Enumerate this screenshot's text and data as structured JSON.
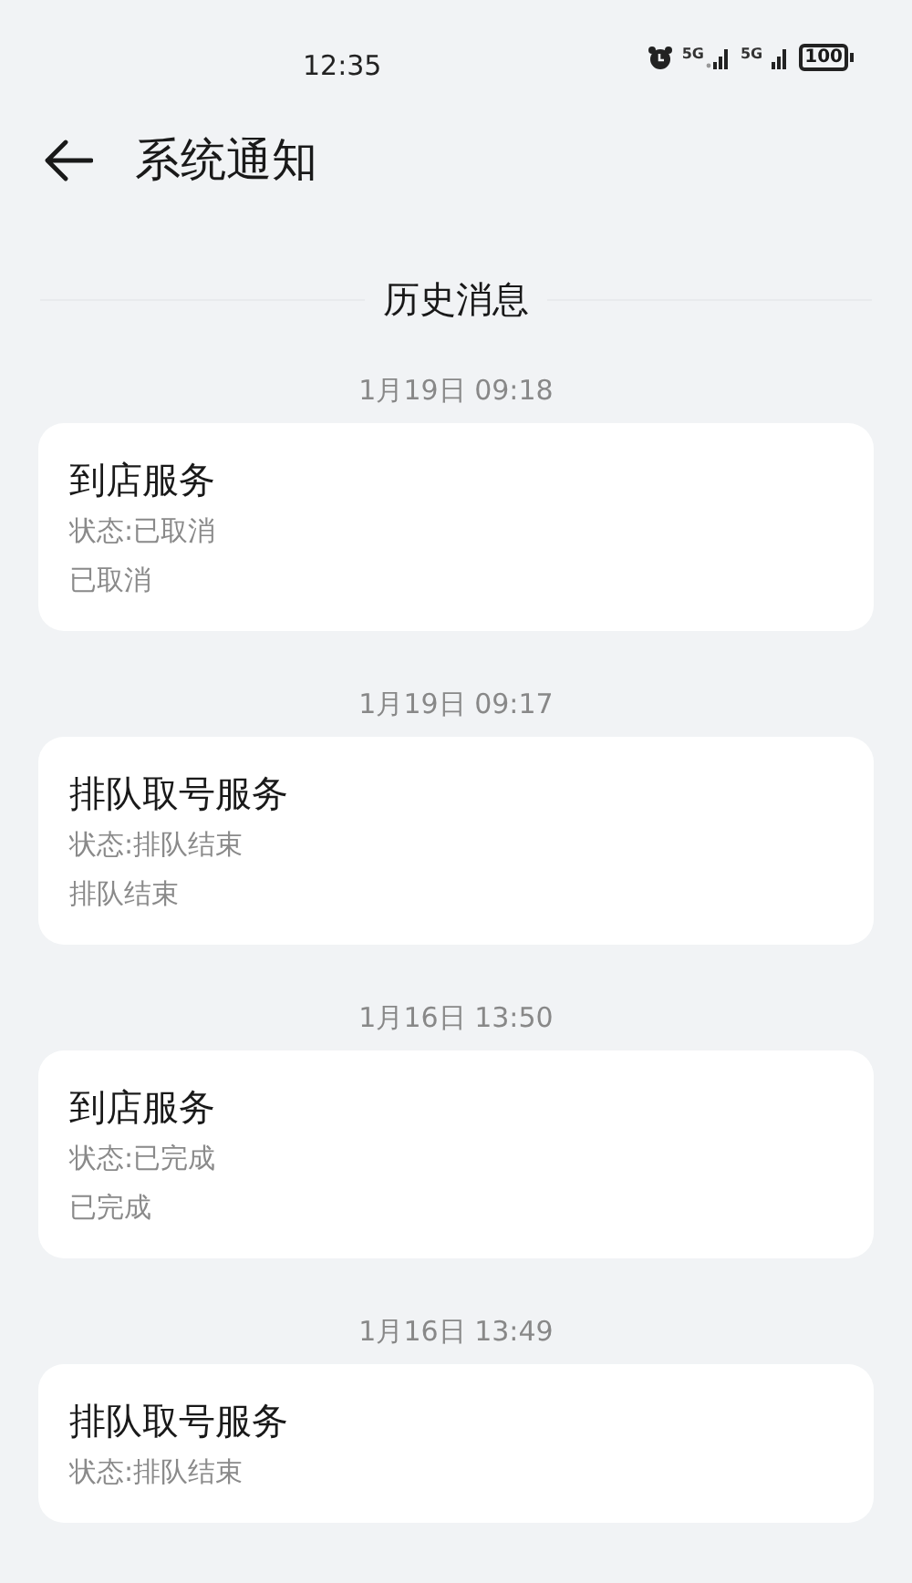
{
  "status_bar": {
    "time": "12:35",
    "signals": [
      {
        "label": "5G"
      },
      {
        "label": "5G"
      }
    ],
    "battery": "100"
  },
  "header": {
    "title": "系统通知"
  },
  "section": {
    "title": "历史消息"
  },
  "messages": [
    {
      "date": "1月19日 09:18",
      "title": "到店服务",
      "status": "状态:已取消",
      "detail": "已取消"
    },
    {
      "date": "1月19日 09:17",
      "title": "排队取号服务",
      "status": "状态:排队结束",
      "detail": "排队结束"
    },
    {
      "date": "1月16日 13:50",
      "title": "到店服务",
      "status": "状态:已完成",
      "detail": "已完成"
    },
    {
      "date": "1月16日 13:49",
      "title": "排队取号服务",
      "status": "状态:排队结束"
    }
  ]
}
